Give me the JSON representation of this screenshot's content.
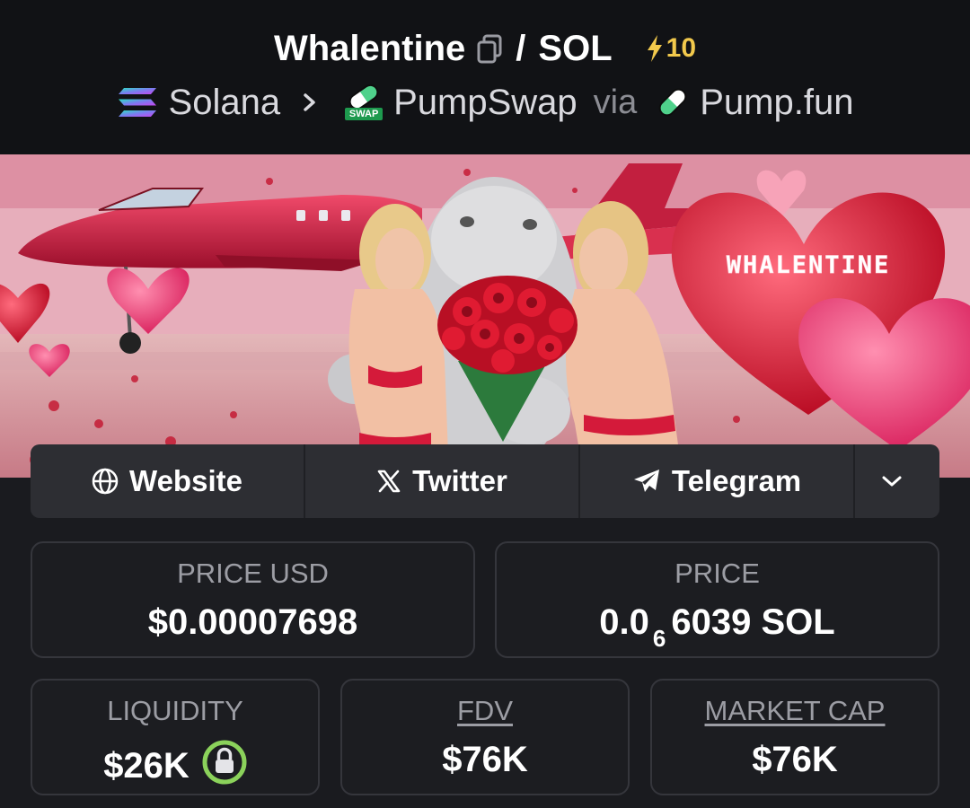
{
  "header": {
    "token_name": "Whalentine",
    "separator": "/",
    "quote": "SOL",
    "boost_count": "10",
    "chain": "Solana",
    "dex": "PumpSwap",
    "dex_badge": "SWAP",
    "via": "via",
    "launchpad": "Pump.fun"
  },
  "banner": {
    "alt_text": "WHALENTINE"
  },
  "links": {
    "website": "Website",
    "twitter": "Twitter",
    "telegram": "Telegram"
  },
  "stats": {
    "price_usd_label": "PRICE USD",
    "price_usd_value": "$0.00007698",
    "price_label": "PRICE",
    "price_prefix": "0.0",
    "price_zero_count": "6",
    "price_suffix": "6039 SOL",
    "liquidity_label": "LIQUIDITY",
    "liquidity_value": "$26K",
    "fdv_label": "FDV",
    "fdv_value": "$76K",
    "mcap_label": "MARKET CAP",
    "mcap_value": "$76K"
  },
  "icons": {
    "copy": "copy-icon",
    "boost": "lightning-icon",
    "chain": "solana-icon",
    "chevron": "chevron-right-icon",
    "dex": "pumpswap-icon",
    "launchpad": "pumpfun-pill-icon",
    "website": "globe-icon",
    "twitter": "x-icon",
    "telegram": "telegram-icon",
    "more": "chevron-down-icon",
    "liquidity_lock": "lock-icon"
  },
  "colors": {
    "background": "#1a1b1f",
    "header_bg": "#111215",
    "boost": "#f2c94c",
    "lock_ring": "#8bd25b"
  }
}
